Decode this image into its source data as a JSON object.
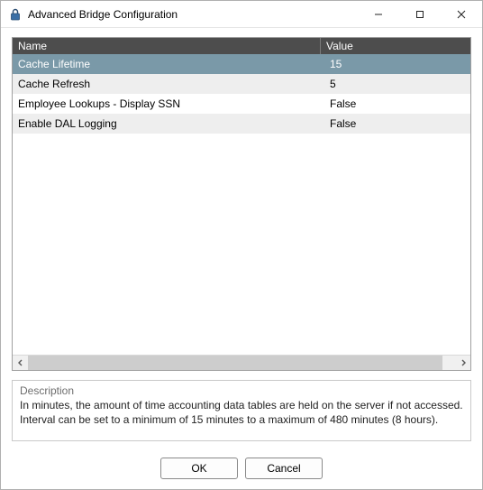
{
  "window": {
    "title": "Advanced Bridge Configuration"
  },
  "grid": {
    "headers": {
      "name": "Name",
      "value": "Value"
    },
    "rows": [
      {
        "name": "Cache Lifetime",
        "value": "15",
        "selected": true
      },
      {
        "name": "Cache Refresh",
        "value": "5",
        "selected": false
      },
      {
        "name": "Employee Lookups - Display SSN",
        "value": "False",
        "selected": false
      },
      {
        "name": "Enable DAL Logging",
        "value": "False",
        "selected": false
      }
    ]
  },
  "description": {
    "label": "Description",
    "text": "In minutes, the amount of time accounting data tables are held on the server if not accessed.  Interval can be set to a minimum of 15 minutes to a maximum of 480 minutes (8 hours)."
  },
  "buttons": {
    "ok": "OK",
    "cancel": "Cancel"
  }
}
